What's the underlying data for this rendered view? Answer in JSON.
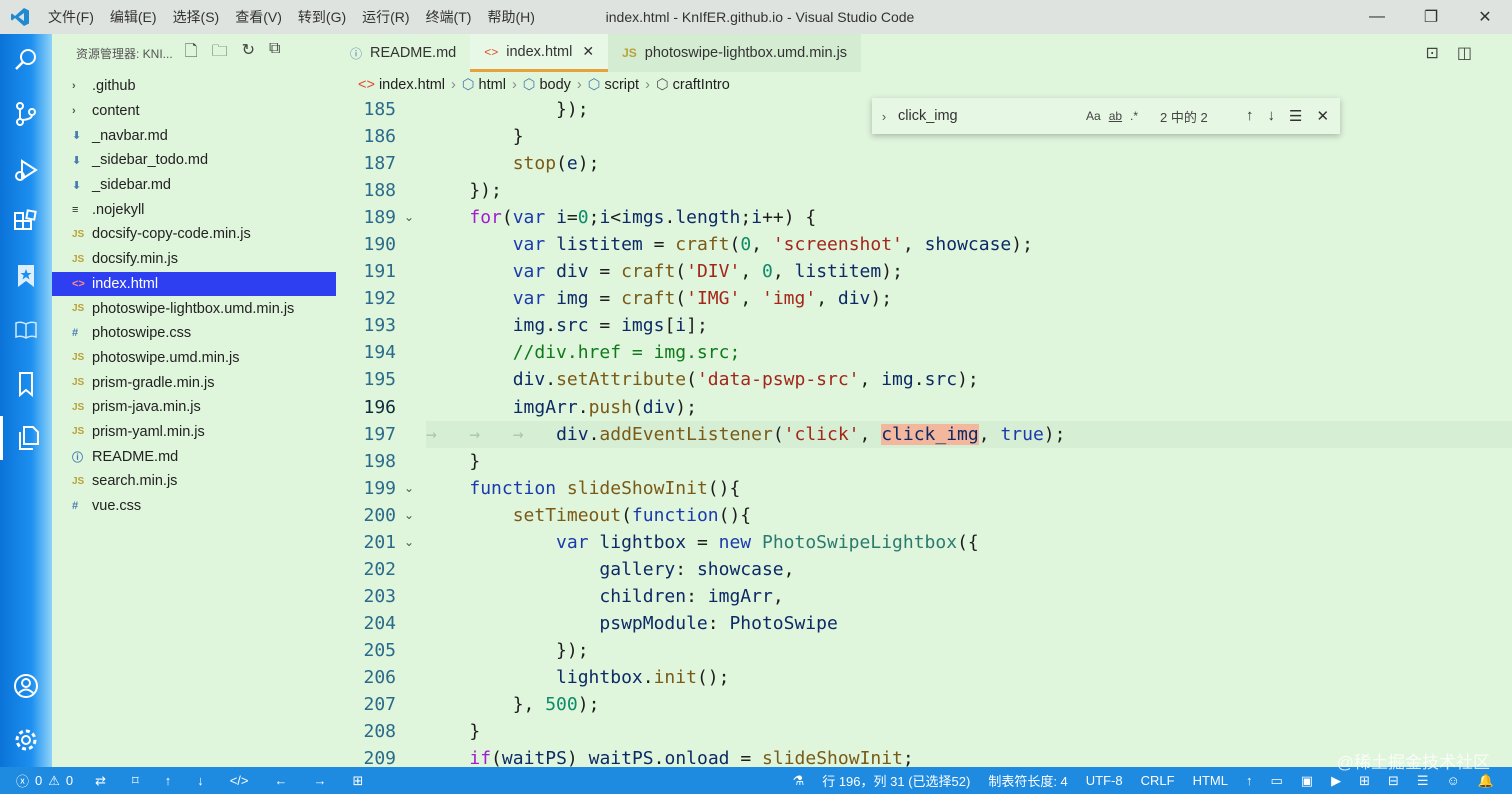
{
  "window": {
    "title": "index.html - KnIfER.github.io - Visual Studio Code",
    "menu": [
      "文件(F)",
      "编辑(E)",
      "选择(S)",
      "查看(V)",
      "转到(G)",
      "运行(R)",
      "终端(T)",
      "帮助(H)"
    ],
    "controls": [
      "—",
      "❐",
      "✕"
    ]
  },
  "sidebar": {
    "title": "资源管理器: KNI...",
    "items": [
      {
        "label": ".github",
        "icon": "chevron-right-icon",
        "kind": "folder"
      },
      {
        "label": "content",
        "icon": "chevron-right-icon",
        "kind": "folder"
      },
      {
        "label": "_navbar.md",
        "icon": "markdown-icon",
        "kind": "md"
      },
      {
        "label": "_sidebar_todo.md",
        "icon": "markdown-icon",
        "kind": "md"
      },
      {
        "label": "_sidebar.md",
        "icon": "markdown-icon",
        "kind": "md"
      },
      {
        "label": ".nojekyll",
        "icon": "file-icon",
        "kind": "plain"
      },
      {
        "label": "docsify-copy-code.min.js",
        "icon": "js-icon",
        "kind": "js"
      },
      {
        "label": "docsify.min.js",
        "icon": "js-icon",
        "kind": "js"
      },
      {
        "label": "index.html",
        "icon": "html-icon",
        "kind": "html",
        "selected": true
      },
      {
        "label": "photoswipe-lightbox.umd.min.js",
        "icon": "js-icon",
        "kind": "js"
      },
      {
        "label": "photoswipe.css",
        "icon": "css-icon",
        "kind": "css"
      },
      {
        "label": "photoswipe.umd.min.js",
        "icon": "js-icon",
        "kind": "js"
      },
      {
        "label": "prism-gradle.min.js",
        "icon": "js-icon",
        "kind": "js"
      },
      {
        "label": "prism-java.min.js",
        "icon": "js-icon",
        "kind": "js"
      },
      {
        "label": "prism-yaml.min.js",
        "icon": "js-icon",
        "kind": "js"
      },
      {
        "label": "README.md",
        "icon": "info-icon",
        "kind": "info"
      },
      {
        "label": "search.min.js",
        "icon": "js-icon",
        "kind": "js"
      },
      {
        "label": "vue.css",
        "icon": "css-icon",
        "kind": "css"
      }
    ]
  },
  "tabs": [
    {
      "label": "README.md",
      "icon": "ⓘ"
    },
    {
      "label": "index.html",
      "icon": "<>",
      "active": true
    },
    {
      "label": "photoswipe-lightbox.umd.min.js",
      "icon": "JS"
    }
  ],
  "breadcrumb": [
    "index.html",
    "html",
    "body",
    "script",
    "craftIntro"
  ],
  "find": {
    "query": "click_img",
    "opt_case": "Aa",
    "opt_word": "ab",
    "opt_regex": ".*",
    "count": "2 中的 2"
  },
  "editor": {
    "line_numbers": [
      "185",
      "186",
      "187",
      "188",
      "189",
      "190",
      "191",
      "192",
      "193",
      "194",
      "195",
      "196",
      "197",
      "198",
      "199",
      "200",
      "201",
      "202",
      "203",
      "204",
      "205",
      "206",
      "207",
      "208",
      "209"
    ],
    "current_line": "196"
  },
  "status": {
    "errors": "0",
    "warnings": "0",
    "cursor": "行 196，列 31 (已选择52)",
    "tab_size": "制表符长度: 4",
    "encoding": "UTF-8",
    "eol": "CRLF",
    "language": "HTML"
  },
  "watermark": "@稀土掘金技术社区",
  "colors": {
    "status_bar": "#1e8ae0",
    "selected_item": "#2d3ff0",
    "editor_bg": "#dff5dc",
    "active_tab_border": "#e8a23a"
  }
}
